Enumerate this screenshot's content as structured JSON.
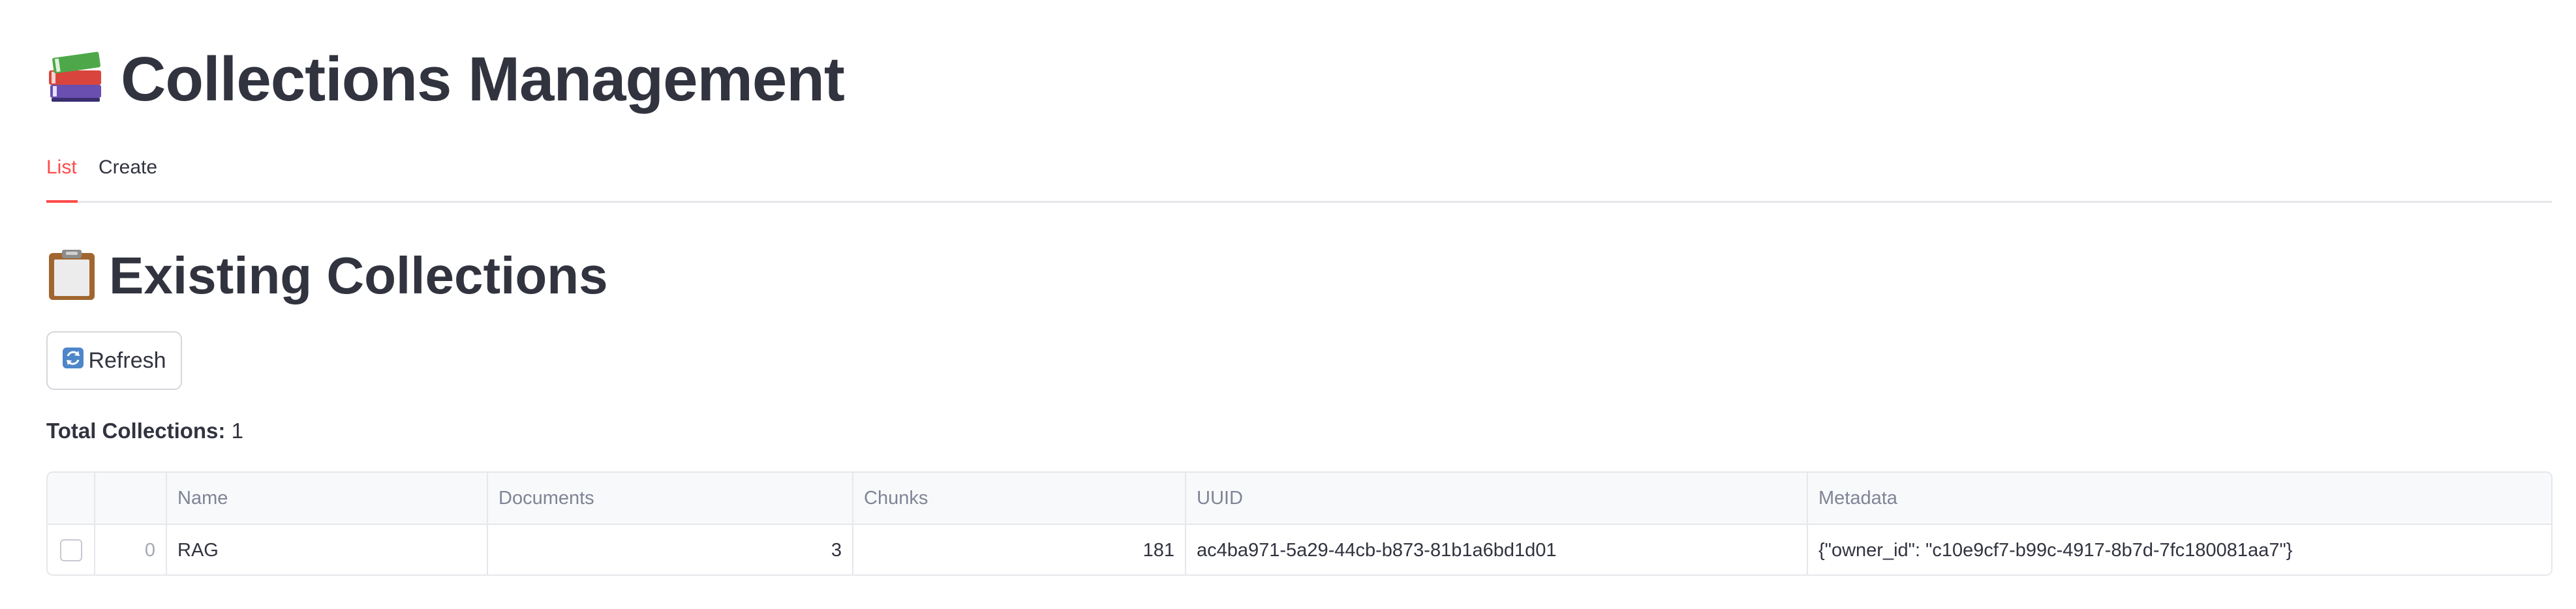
{
  "header": {
    "title": "Collections Management",
    "title_icon": "books-icon"
  },
  "tabs": [
    {
      "label": "List",
      "active": true
    },
    {
      "label": "Create",
      "active": false
    }
  ],
  "section": {
    "title": "Existing Collections",
    "title_icon": "clipboard-icon"
  },
  "refresh_button": {
    "label": "Refresh",
    "icon": "refresh-icon"
  },
  "summary": {
    "total_label": "Total Collections:",
    "total_value": "1"
  },
  "table": {
    "columns": [
      "",
      "",
      "Name",
      "Documents",
      "Chunks",
      "UUID",
      "Metadata"
    ],
    "rows": [
      {
        "index": "0",
        "name": "RAG",
        "documents": "3",
        "chunks": "181",
        "uuid": "ac4ba971-5a29-44cb-b873-81b1a6bd1d01",
        "metadata": "{\"owner_id\": \"c10e9cf7-b99c-4917-8b7d-7fc180081aa7\"}"
      }
    ]
  },
  "colors": {
    "accent": "#ff4b4b",
    "text": "#31333f",
    "muted": "#808495",
    "border": "#e6e7eb",
    "header_bg": "#f8f9fb"
  }
}
